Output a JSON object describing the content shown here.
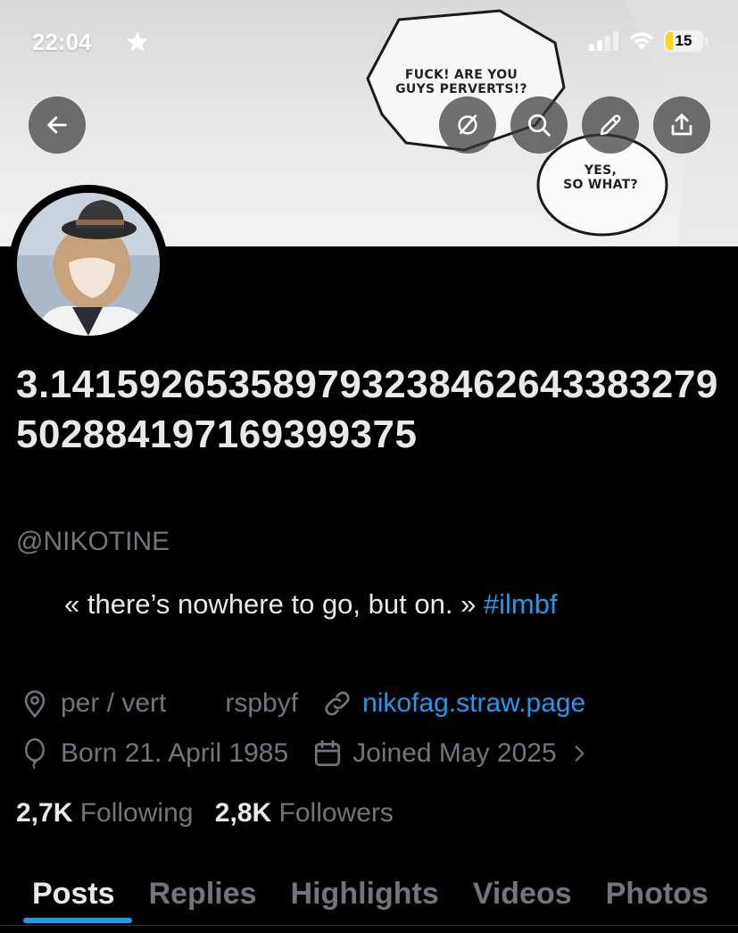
{
  "status_bar": {
    "time": "22:04",
    "battery": "15"
  },
  "banner": {
    "bubble_top": [
      "FUCK! ARE YOU",
      "GUYS PERVERTS!?"
    ],
    "bubble_bottom": [
      "YES,",
      "SO WHAT?"
    ]
  },
  "header_buttons": {
    "back_icon": "arrow-left-icon",
    "grok_icon": "grok-icon",
    "search_icon": "search-icon",
    "edit_icon": "pencil-icon",
    "share_icon": "share-icon"
  },
  "profile": {
    "display_name": "3.141592653589793238462643383279502884197169399375",
    "handle": "@NIKOTINE",
    "bio_text": "« there’s nowhere to go, but on. » ",
    "bio_hashtag": "#ilmbf",
    "location": "per / vert",
    "professional_category": "rspbyf",
    "website": "nikofag.straw.page",
    "birthday": "Born 21. April 1985",
    "joined": "Joined May 2025"
  },
  "stats": {
    "following_count": "2,7K",
    "following_label": "Following",
    "followers_count": "2,8K",
    "followers_label": "Followers"
  },
  "tabs": [
    {
      "label": "Posts",
      "active": true
    },
    {
      "label": "Replies",
      "active": false
    },
    {
      "label": "Highlights",
      "active": false
    },
    {
      "label": "Videos",
      "active": false
    },
    {
      "label": "Photos",
      "active": false
    }
  ],
  "colors": {
    "accent": "#1d9bf0",
    "background": "#000000",
    "muted_text": "#71767b",
    "primary_text": "#e7e9ea"
  }
}
